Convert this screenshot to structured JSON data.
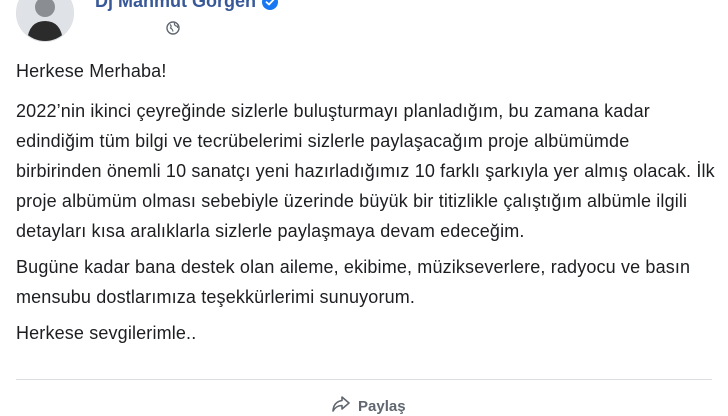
{
  "post": {
    "author": "Dj Mahmut Görgen",
    "author_verified": true,
    "privacy_icon": "globe-icon",
    "greeting": "Herkese Merhaba!",
    "paragraph_1": "2022’nin ikinci çeyreğinde sizlerle buluşturmayı planladığım, bu zamana kadar edindiğim tüm bilgi ve tecrübelerimi sizlerle paylaşacağım proje albümümde birbirinden önemli 10 sanatçı yeni hazırladığımız 10 farklı şarkıyla yer almış olacak. İlk proje albümüm olması sebebiyle üzerinde büyük bir titizlikle çalıştığım albümle ilgili detayları kısa aralıklarla sizlerle paylaşmaya devam edeceğim.",
    "paragraph_2": "Bugüne kadar bana destek olan aileme, ekibime, müzikseverlere, radyocu ve basın mensubu dostlarımıza teşekkürlerimi sunuyorum.",
    "closing": "Herkese sevgilerimle.."
  },
  "actions": {
    "share_label": "Paylaş",
    "share_icon": "share-icon"
  },
  "colors": {
    "author_link": "#385898",
    "verified_badge": "#1877f2",
    "text": "#1c1e21",
    "muted": "#606770"
  }
}
